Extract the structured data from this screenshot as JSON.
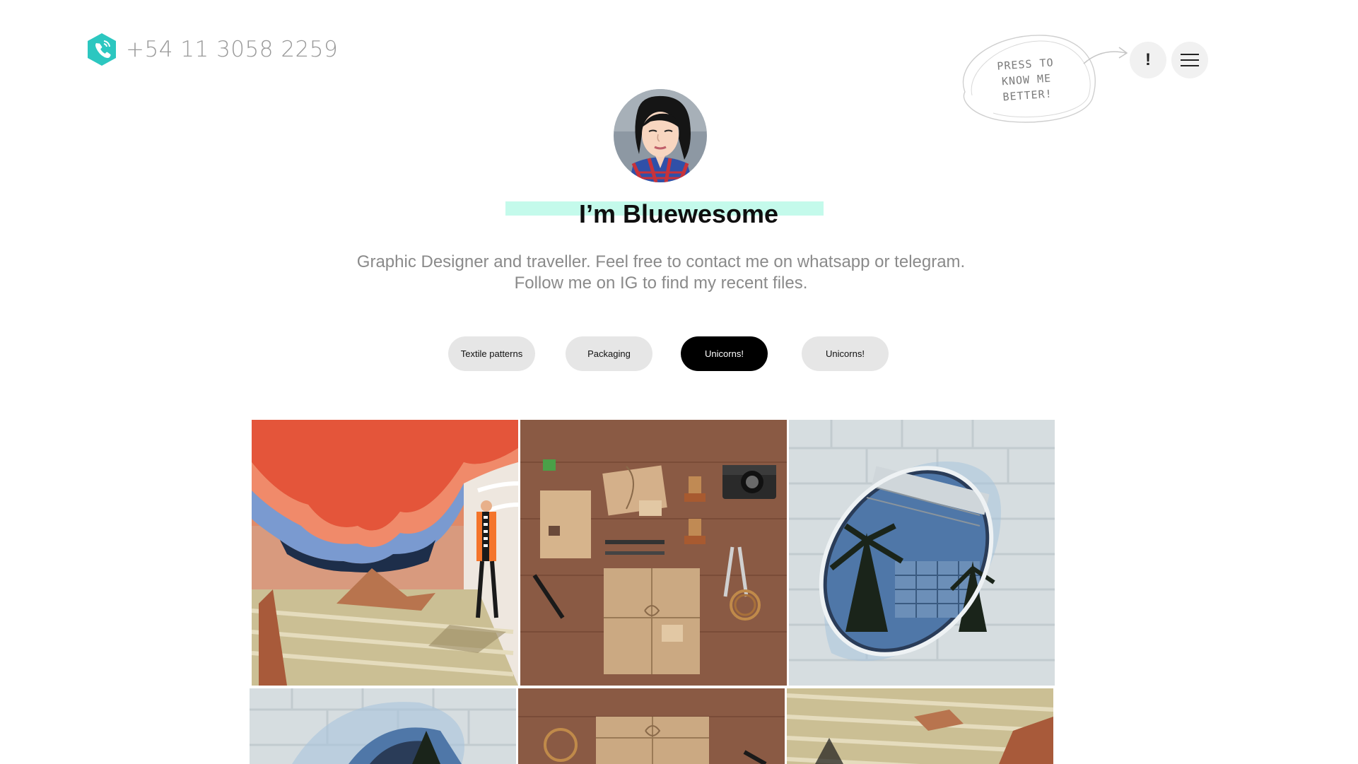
{
  "header": {
    "phone_number": "+54 11 3058 2259",
    "phone_icon": "phone-hexagon-icon",
    "note_line1": "PRESS TO",
    "note_line2": "KNOW ME BETTER!",
    "info_label": "!",
    "menu_icon": "hamburger-menu-icon"
  },
  "hero": {
    "title": "I’m Bluewesome",
    "subtitle_line1": "Graphic Designer and traveller. Feel free to contact me on whatsapp or telegram.",
    "subtitle_line2": "Follow me on IG to find my recent files."
  },
  "filters": [
    {
      "label": "Textile patterns",
      "active": false
    },
    {
      "label": "Packaging",
      "active": false
    },
    {
      "label": "Unicorns!",
      "active": true
    },
    {
      "label": "Unicorns!",
      "active": false
    }
  ],
  "colors": {
    "accent_teal": "#2cc7c0",
    "highlight": "#c4faeb",
    "text_gray": "#8a8a8a"
  }
}
